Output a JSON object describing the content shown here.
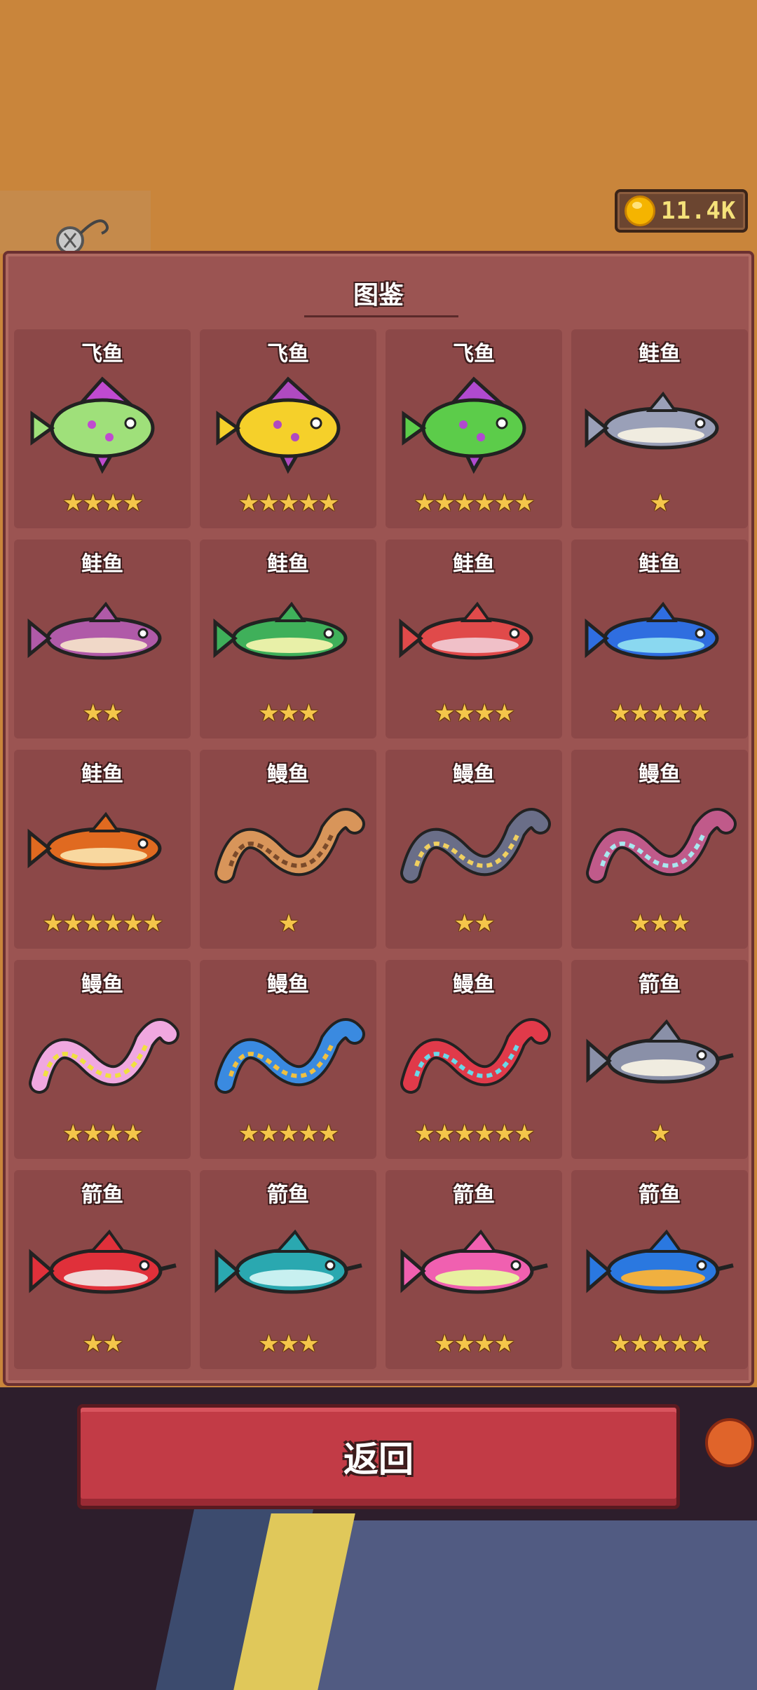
{
  "currency": {
    "icon": "gold-coin-icon",
    "amount": "11.4K"
  },
  "panel": {
    "title": "图鉴"
  },
  "cards": [
    {
      "name": "飞鱼",
      "stars": "★★★★",
      "colors": [
        "#9fe07a",
        "#c04ad0"
      ]
    },
    {
      "name": "飞鱼",
      "stars": "★★★★★",
      "colors": [
        "#f5d02a",
        "#b04ac0"
      ]
    },
    {
      "name": "飞鱼",
      "stars": "★★★★★★",
      "colors": [
        "#5ccc4a",
        "#b04ad0"
      ]
    },
    {
      "name": "鲑鱼",
      "stars": "★",
      "colors": [
        "#9aa0b8",
        "#f0ece0"
      ]
    },
    {
      "name": "鲑鱼",
      "stars": "★★",
      "colors": [
        "#b05aa8",
        "#f0d8c8"
      ]
    },
    {
      "name": "鲑鱼",
      "stars": "★★★",
      "colors": [
        "#3fb05a",
        "#e8f0a8"
      ]
    },
    {
      "name": "鲑鱼",
      "stars": "★★★★",
      "colors": [
        "#e04a4a",
        "#f0c0c8"
      ]
    },
    {
      "name": "鲑鱼",
      "stars": "★★★★★",
      "colors": [
        "#2f6ee0",
        "#8ad8f0"
      ]
    },
    {
      "name": "鲑鱼",
      "stars": "★★★★★★",
      "colors": [
        "#e06a20",
        "#f8d8a0"
      ]
    },
    {
      "name": "鳗鱼",
      "stars": "★",
      "colors": [
        "#d8955a",
        "#7a4a2a"
      ]
    },
    {
      "name": "鳗鱼",
      "stars": "★★",
      "colors": [
        "#6a6e88",
        "#f0d060"
      ]
    },
    {
      "name": "鳗鱼",
      "stars": "★★★",
      "colors": [
        "#c05a8a",
        "#a8e8f0"
      ]
    },
    {
      "name": "鳗鱼",
      "stars": "★★★★",
      "colors": [
        "#f0a8e0",
        "#f0e040"
      ]
    },
    {
      "name": "鳗鱼",
      "stars": "★★★★★",
      "colors": [
        "#3a8ae0",
        "#f0c040"
      ]
    },
    {
      "name": "鳗鱼",
      "stars": "★★★★★★",
      "colors": [
        "#e03a4a",
        "#6ad8e8"
      ]
    },
    {
      "name": "箭鱼",
      "stars": "★",
      "colors": [
        "#8a90a8",
        "#f0ece0"
      ]
    },
    {
      "name": "箭鱼",
      "stars": "★★",
      "colors": [
        "#e0303a",
        "#f0d8d8"
      ]
    },
    {
      "name": "箭鱼",
      "stars": "★★★",
      "colors": [
        "#2aa8b0",
        "#c8f0f0"
      ]
    },
    {
      "name": "箭鱼",
      "stars": "★★★★",
      "colors": [
        "#f060b0",
        "#e8f0a0"
      ]
    },
    {
      "name": "箭鱼",
      "stars": "★★★★★",
      "colors": [
        "#2a78e0",
        "#f0b040"
      ]
    }
  ],
  "back_button": {
    "label": "返回"
  }
}
